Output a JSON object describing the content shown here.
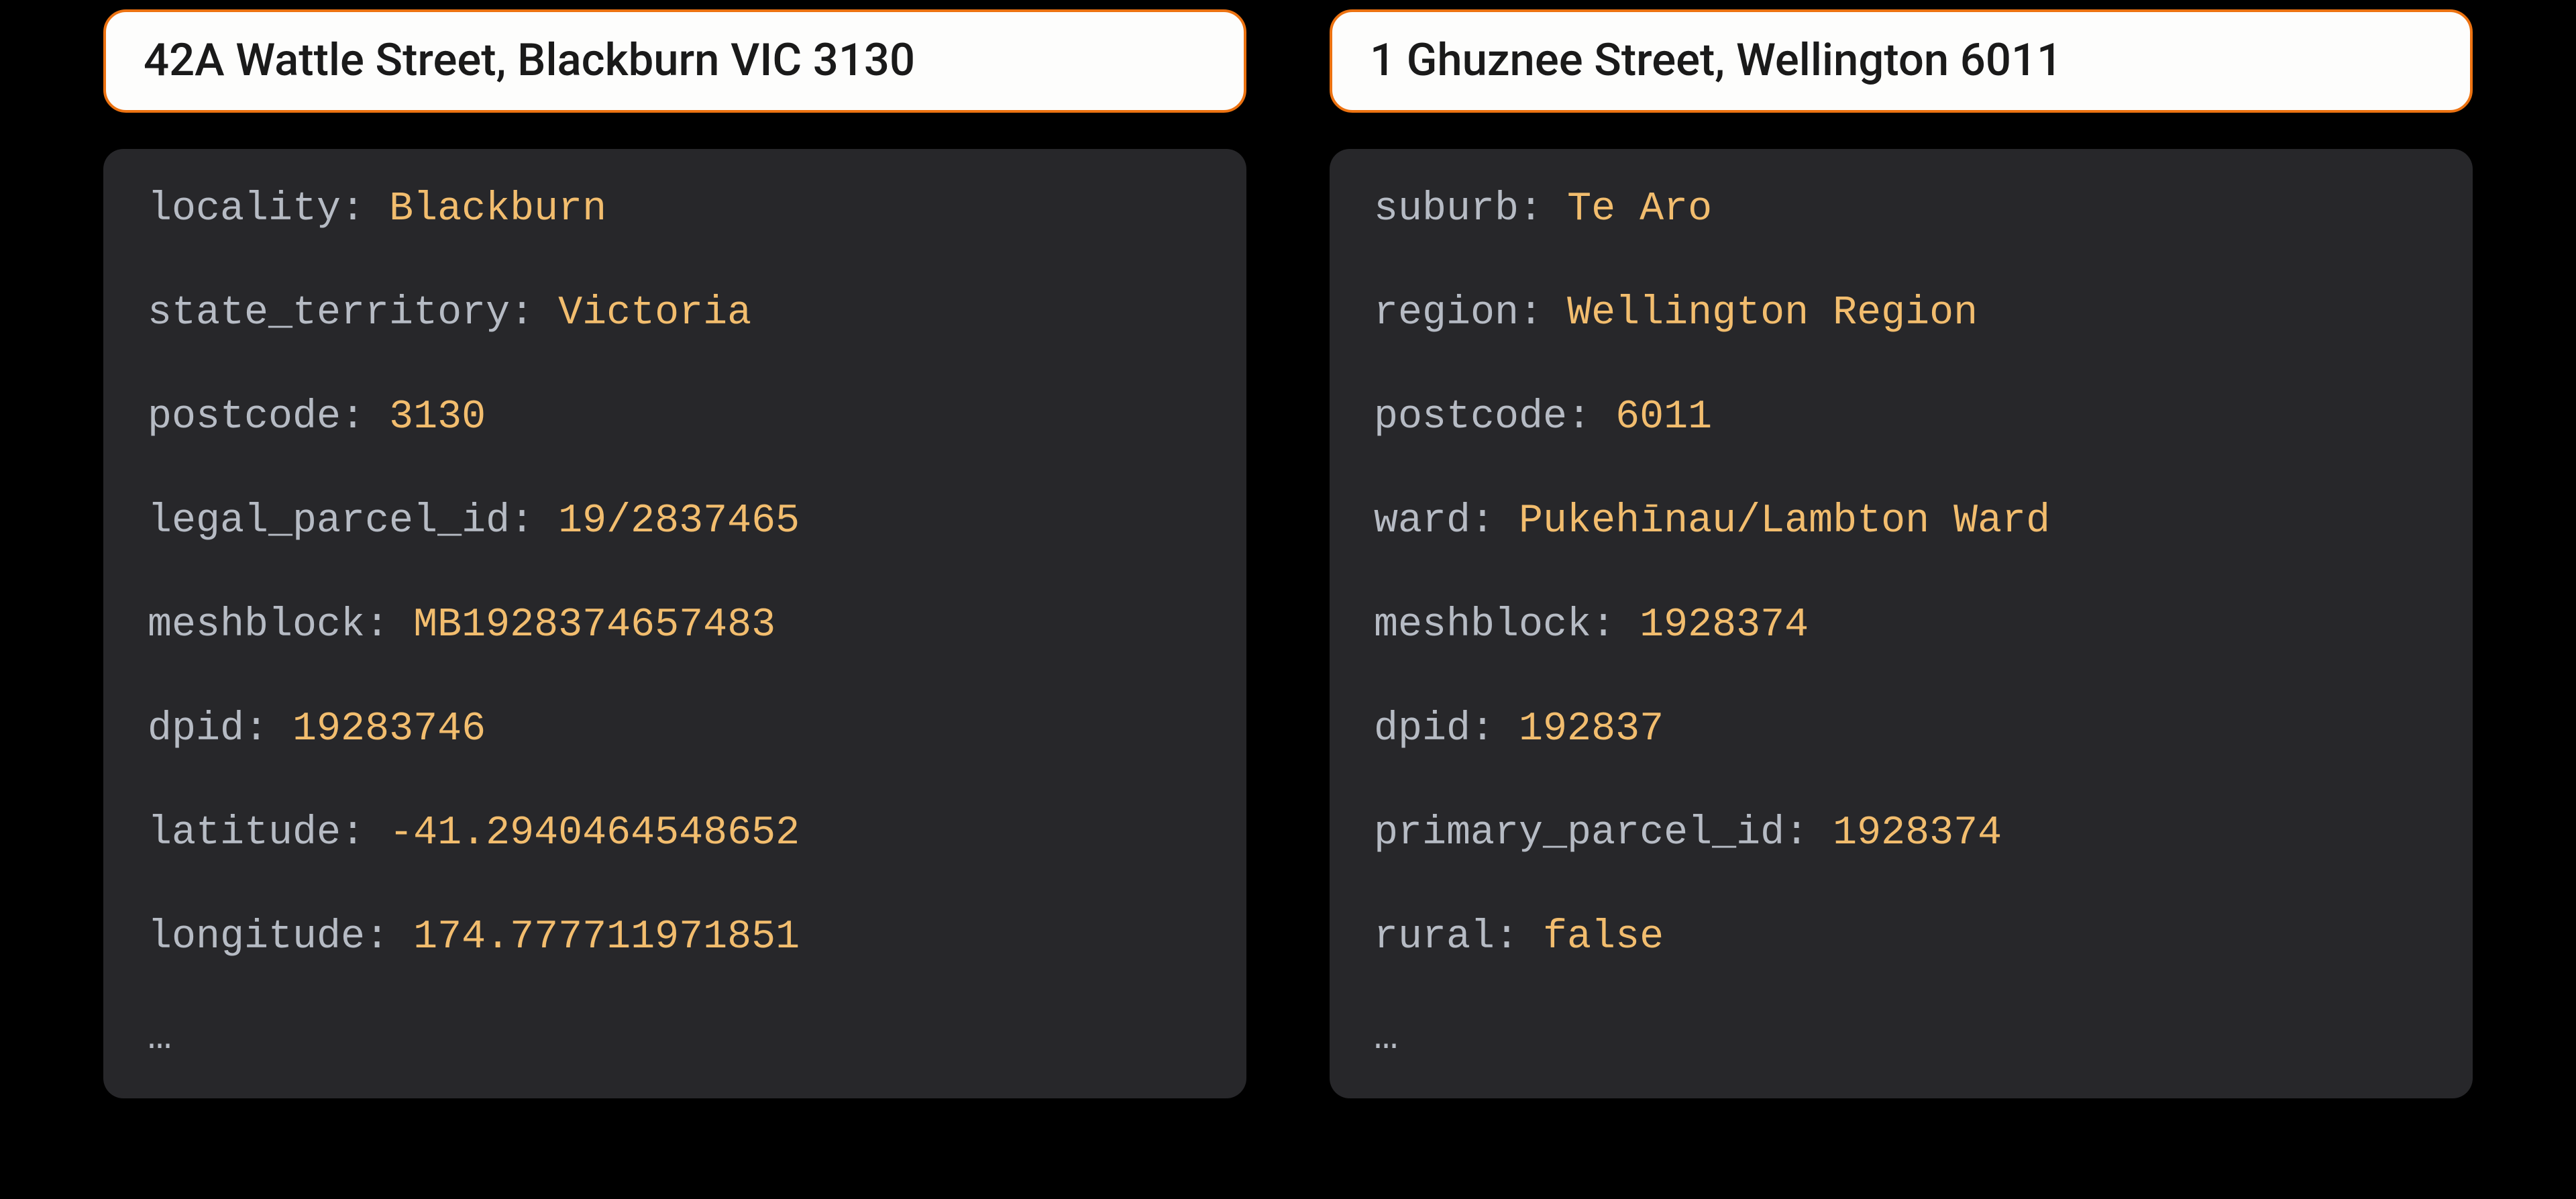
{
  "cards": [
    {
      "address": "42A Wattle Street, Blackburn VIC 3130",
      "fields": [
        {
          "k": "locality",
          "v": "Blackburn"
        },
        {
          "k": "state_territory",
          "v": "Victoria"
        },
        {
          "k": "postcode",
          "v": "3130"
        },
        {
          "k": "legal_parcel_id",
          "v": "19/2837465"
        },
        {
          "k": "meshblock",
          "v": "MB1928374657483"
        },
        {
          "k": "dpid",
          "v": "19283746"
        },
        {
          "k": "latitude",
          "v": "-41.2940464548652"
        },
        {
          "k": "longitude",
          "v": "174.777711971851"
        }
      ],
      "ellipsis": "…"
    },
    {
      "address": "1 Ghuznee Street, Wellington 6011",
      "fields": [
        {
          "k": "suburb",
          "v": "Te Aro"
        },
        {
          "k": "region",
          "v": "Wellington Region"
        },
        {
          "k": "postcode",
          "v": "6011"
        },
        {
          "k": "ward",
          "v": "Pukehīnau/Lambton Ward"
        },
        {
          "k": "meshblock",
          "v": "1928374"
        },
        {
          "k": "dpid",
          "v": "192837"
        },
        {
          "k": "primary_parcel_id",
          "v": "1928374"
        },
        {
          "k": "rural",
          "v": "false"
        }
      ],
      "ellipsis": "…"
    }
  ]
}
